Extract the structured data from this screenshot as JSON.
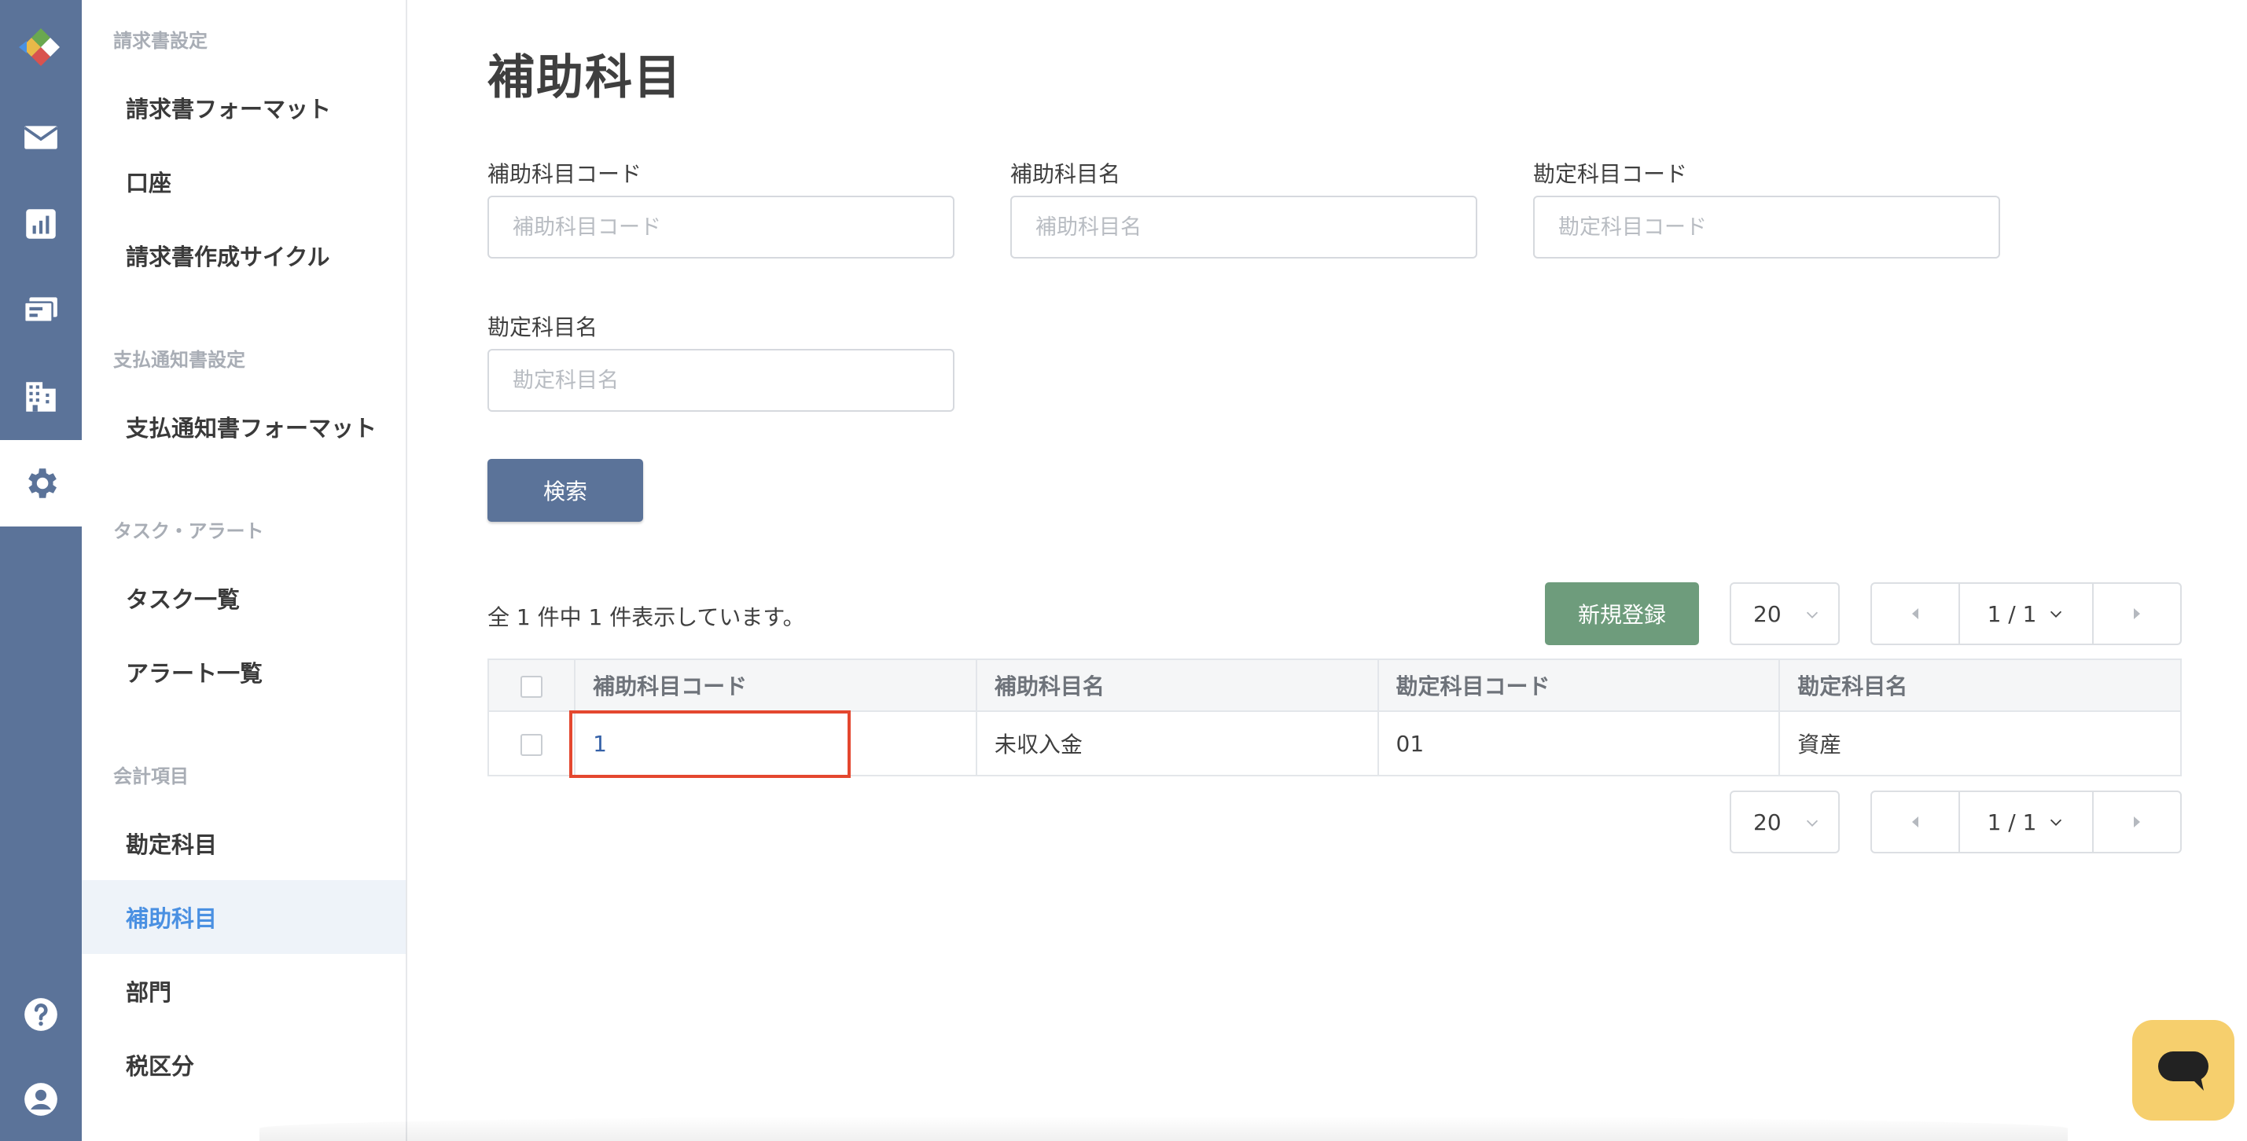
{
  "rail": {
    "items": [
      {
        "name": "mail-icon",
        "active": false
      },
      {
        "name": "report-chart-icon",
        "active": false
      },
      {
        "name": "payment-icon",
        "active": false
      },
      {
        "name": "building-icon",
        "active": false
      },
      {
        "name": "gear-icon",
        "active": true
      }
    ],
    "bottom": [
      "help-icon",
      "account-icon"
    ]
  },
  "sidebar": {
    "sections": [
      {
        "title": "請求書設定",
        "items": [
          "請求書フォーマット",
          "口座",
          "請求書作成サイクル"
        ]
      },
      {
        "title": "支払通知書設定",
        "items": [
          "支払通知書フォーマット"
        ]
      },
      {
        "title": "タスク・アラート",
        "items": [
          "タスク一覧",
          "アラート一覧"
        ]
      },
      {
        "title": "会計項目",
        "items": [
          "勘定科目",
          "補助科目",
          "部門",
          "税区分"
        ]
      }
    ],
    "active_item": "補助科目"
  },
  "page": {
    "title": "補助科目"
  },
  "filters": {
    "sub_account_code": {
      "label": "補助科目コード",
      "placeholder": "補助科目コード",
      "value": ""
    },
    "sub_account_name": {
      "label": "補助科目名",
      "placeholder": "補助科目名",
      "value": ""
    },
    "account_code": {
      "label": "勘定科目コード",
      "placeholder": "勘定科目コード",
      "value": ""
    },
    "account_name": {
      "label": "勘定科目名",
      "placeholder": "勘定科目名",
      "value": ""
    },
    "search_button": "検索"
  },
  "results": {
    "count_text": "全 1 件中 1 件表示しています。",
    "new_button": "新規登録",
    "per_page": "20",
    "page_indicator": "1 / 1"
  },
  "table": {
    "columns": [
      "補助科目コード",
      "補助科目名",
      "勘定科目コード",
      "勘定科目名"
    ],
    "rows": [
      {
        "code": "1",
        "name": "未収入金",
        "account_code": "01",
        "account_name": "資産"
      }
    ]
  },
  "colors": {
    "rail": "#5b7399",
    "primary_button": "#5b7399",
    "new_button": "#6e9c7c",
    "active_link": "#4a90e2",
    "highlight": "#e4472f",
    "chat": "#f6cf6d"
  }
}
